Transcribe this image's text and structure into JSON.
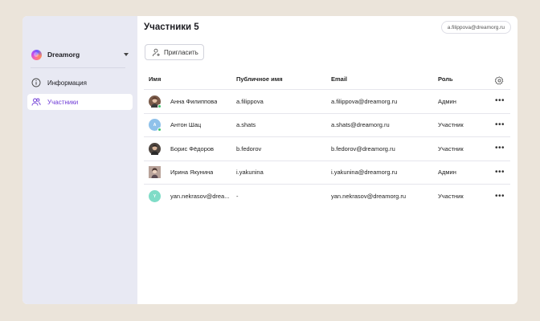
{
  "sidebar": {
    "org_name": "Dreamorg",
    "items": [
      {
        "label": "Информация",
        "icon": "info-icon",
        "active": false
      },
      {
        "label": "Участники",
        "icon": "users-icon",
        "active": true
      }
    ]
  },
  "header": {
    "title": "Участники 5",
    "account_email": "a.filippova@dreamorg.ru"
  },
  "invite_label": "Пригласить",
  "table": {
    "columns": [
      "Имя",
      "Публичное имя",
      "Email",
      "Роль"
    ],
    "rows": [
      {
        "name": "Анна Филиппова",
        "public": "a.filippova",
        "email": "a.filippova@dreamorg.ru",
        "role": "Админ",
        "avatar": "photo",
        "avatar_color": "#7a5b4a",
        "online": true
      },
      {
        "name": "Антон Шац",
        "public": "a.shats",
        "email": "a.shats@dreamorg.ru",
        "role": "Участник",
        "avatar": "A",
        "avatar_color": "#8fc1ea",
        "online": true
      },
      {
        "name": "Борис Фёдоров",
        "public": "b.fedorov",
        "email": "b.fedorov@dreamorg.ru",
        "role": "Участник",
        "avatar": "photo",
        "avatar_color": "#4e4640",
        "online": false
      },
      {
        "name": "Ирина Якунина",
        "public": "i.yakunina",
        "email": "i.yakunina@dreamorg.ru",
        "role": "Админ",
        "avatar": "photo",
        "avatar_color": "#8a6f66",
        "online": false
      },
      {
        "name": "yan.nekrasov@drea...",
        "public": "-",
        "email": "yan.nekrasov@dreamorg.ru",
        "role": "Участник",
        "avatar": "Y",
        "avatar_color": "#7fdcc7",
        "online": false
      }
    ],
    "more_label": "•••"
  },
  "colors": {
    "background": "#ebe4da",
    "sidebar": "#e8e9f3",
    "accent": "#6f3cd6",
    "online": "#3cc46b"
  }
}
